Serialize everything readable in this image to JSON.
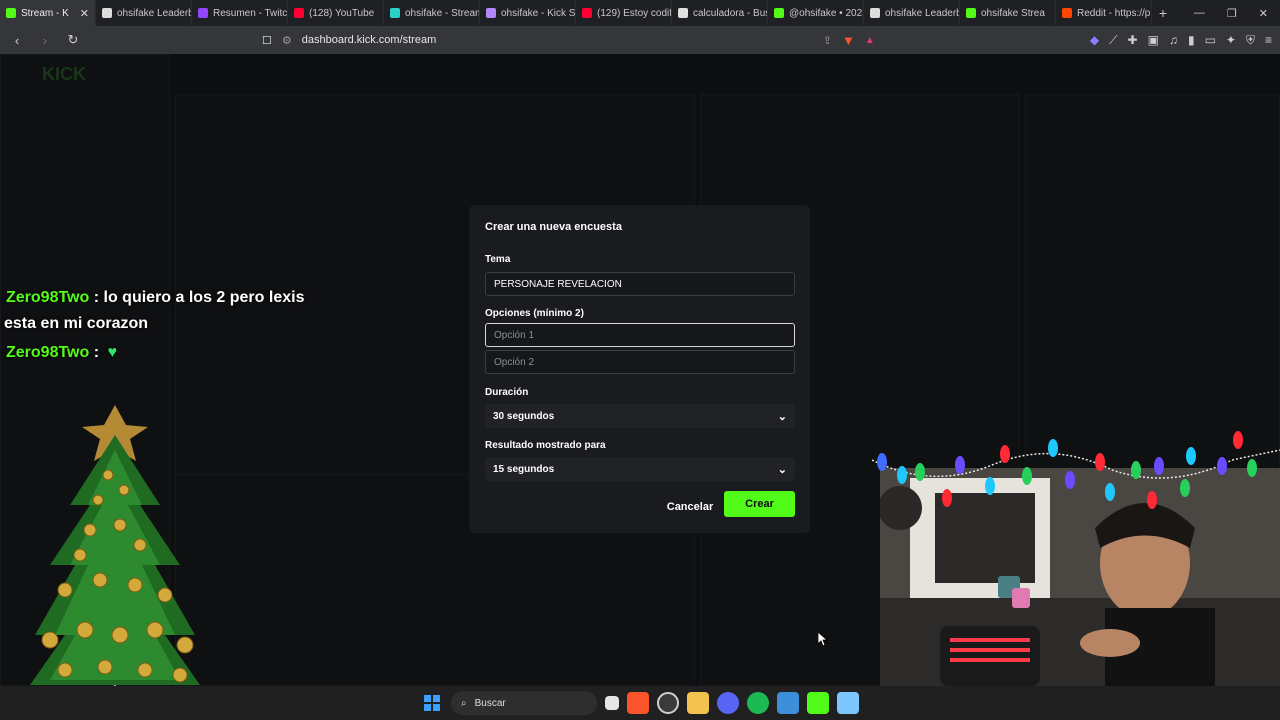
{
  "browser": {
    "tabs": [
      {
        "label": "Stream - K",
        "color": "#53fc18",
        "active": true
      },
      {
        "label": "ohsifake Leaderb",
        "color": "#dddddd"
      },
      {
        "label": "Resumen - Twitch",
        "color": "#9146ff"
      },
      {
        "label": "(128) YouTube",
        "color": "#ff0033"
      },
      {
        "label": "ohsifake - Stream",
        "color": "#2ad1c9"
      },
      {
        "label": "ohsifake - Kick St",
        "color": "#b388ff"
      },
      {
        "label": "(129) Estoy codifi",
        "color": "#ff0033"
      },
      {
        "label": "calculadora - Bus",
        "color": "#e0e0e0"
      },
      {
        "label": "@ohsifake • 2023",
        "color": "#53fc18"
      },
      {
        "label": "ohsifake Leaderb",
        "color": "#dddddd"
      },
      {
        "label": "ohsifake Strea",
        "color": "#53fc18"
      },
      {
        "label": "Reddit - https://p",
        "color": "#ff4500"
      }
    ],
    "new_tab": "+",
    "url": "dashboard.kick.com/stream"
  },
  "overlay": {
    "chat": [
      {
        "user": "Zero98Two",
        "text": ": lo quiero a los 2 pero lexis"
      },
      {
        "user": "",
        "text": "esta en mi corazon"
      },
      {
        "user": "Zero98Two",
        "text": ":"
      }
    ],
    "heart": "♥"
  },
  "modal": {
    "title": "Crear una nueva encuesta",
    "topic_label": "Tema",
    "topic_value": "PERSONAJE REVELACION",
    "options_label": "Opciones (mínimo 2)",
    "option1_placeholder": "Opción 1",
    "option2_placeholder": "Opción 2",
    "duration_label": "Duración",
    "duration_value": "30 segundos",
    "result_label": "Resultado mostrado para",
    "result_value": "15 segundos",
    "cancel": "Cancelar",
    "create": "Crear"
  },
  "taskbar": {
    "search": "Buscar"
  },
  "colors": {
    "accent": "#53fc18"
  }
}
